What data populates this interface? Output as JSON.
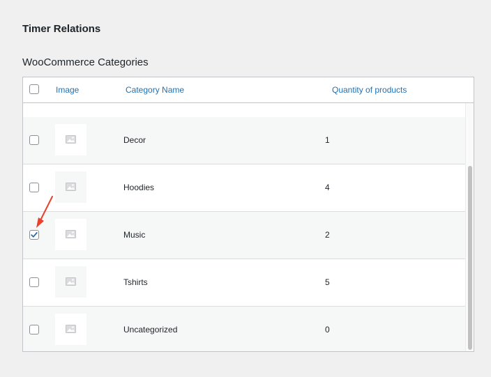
{
  "section": {
    "title": "Timer Relations"
  },
  "categories_panel": {
    "title": "WooCommerce Categories",
    "columns": {
      "image": "Image",
      "name": "Category Name",
      "quantity": "Quantity of products"
    },
    "select_all_checked": false,
    "rows": [
      {
        "name": "Decor",
        "quantity": "1",
        "checked": false
      },
      {
        "name": "Hoodies",
        "quantity": "4",
        "checked": false
      },
      {
        "name": "Music",
        "quantity": "2",
        "checked": true
      },
      {
        "name": "Tshirts",
        "quantity": "5",
        "checked": false
      },
      {
        "name": "Uncategorized",
        "quantity": "0",
        "checked": false
      }
    ]
  },
  "icons": {
    "thumbnail": "image-placeholder-icon",
    "checkmark": "checkmark-icon",
    "annotation": "red-arrow-icon"
  },
  "colors": {
    "link": "#2271b1",
    "checkmark": "#2271b1",
    "annotation_arrow": "#e8412c",
    "row_alt": "#f6f7f7",
    "border": "#c3c4c7"
  }
}
